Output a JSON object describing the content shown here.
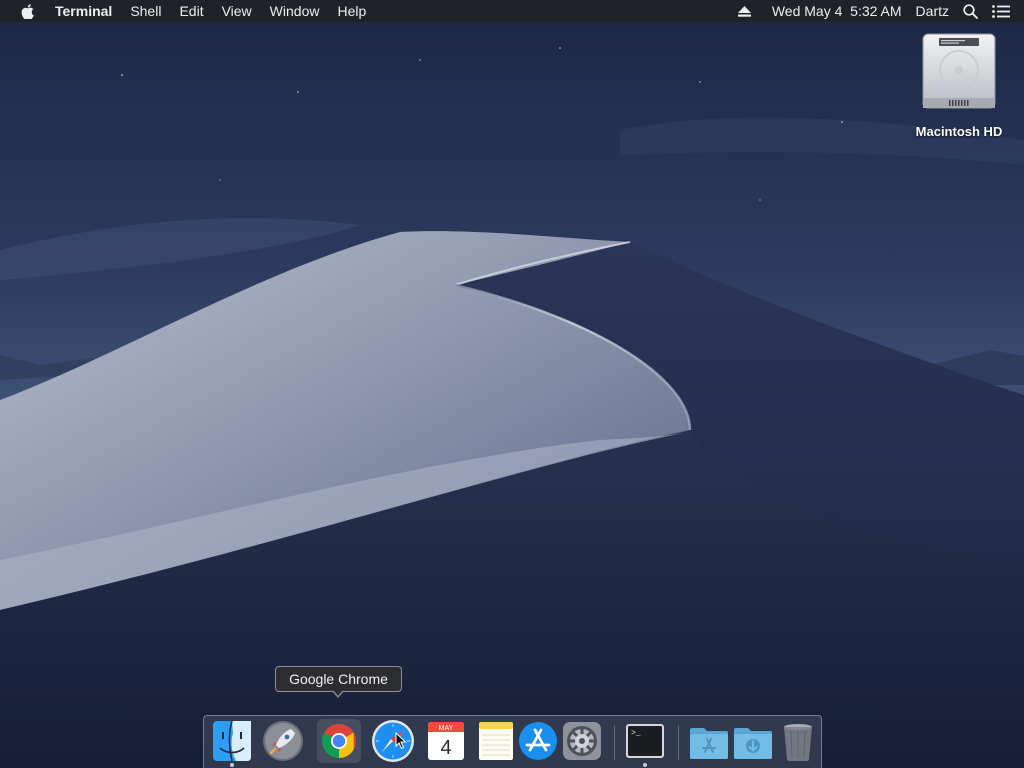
{
  "menubar": {
    "app_name": "Terminal",
    "menus": [
      "Shell",
      "Edit",
      "View",
      "Window",
      "Help"
    ],
    "status": {
      "eject_icon": "eject-icon",
      "datetime": "Wed May 4  5:32 AM",
      "user": "Dartz",
      "search_icon": "spotlight-search-icon",
      "notifications_icon": "notification-center-icon"
    }
  },
  "desktop": {
    "icons": [
      {
        "label": "Macintosh HD",
        "icon": "hard-drive-icon"
      }
    ]
  },
  "tooltip": {
    "text": "Google Chrome"
  },
  "dock": {
    "calendar": {
      "month": "MAY",
      "day": "4"
    },
    "apps": [
      {
        "name": "Finder",
        "icon": "finder-icon",
        "running": true
      },
      {
        "name": "Launchpad",
        "icon": "launchpad-icon",
        "running": false
      },
      {
        "name": "Google Chrome",
        "icon": "chrome-icon",
        "running": false
      },
      {
        "name": "Safari",
        "icon": "safari-icon",
        "running": false
      },
      {
        "name": "Calendar",
        "icon": "calendar-icon",
        "running": false
      },
      {
        "name": "Notes",
        "icon": "notes-icon",
        "running": false
      },
      {
        "name": "App Store",
        "icon": "app-store-icon",
        "running": false
      },
      {
        "name": "System Preferences",
        "icon": "system-preferences-icon",
        "running": false
      },
      {
        "name": "Terminal",
        "icon": "terminal-icon",
        "running": true
      },
      {
        "name": "Applications",
        "icon": "applications-folder-icon",
        "running": false
      },
      {
        "name": "Downloads",
        "icon": "downloads-folder-icon",
        "running": false
      },
      {
        "name": "Trash",
        "icon": "trash-icon",
        "running": false
      }
    ]
  },
  "colors": {
    "menubar_bg": "#1f2226",
    "sky_top": "#1d2a47",
    "sky_bottom": "#3b4d6c",
    "dune_light": "#c9cfdb",
    "dune_shadow": "#232e4c"
  }
}
